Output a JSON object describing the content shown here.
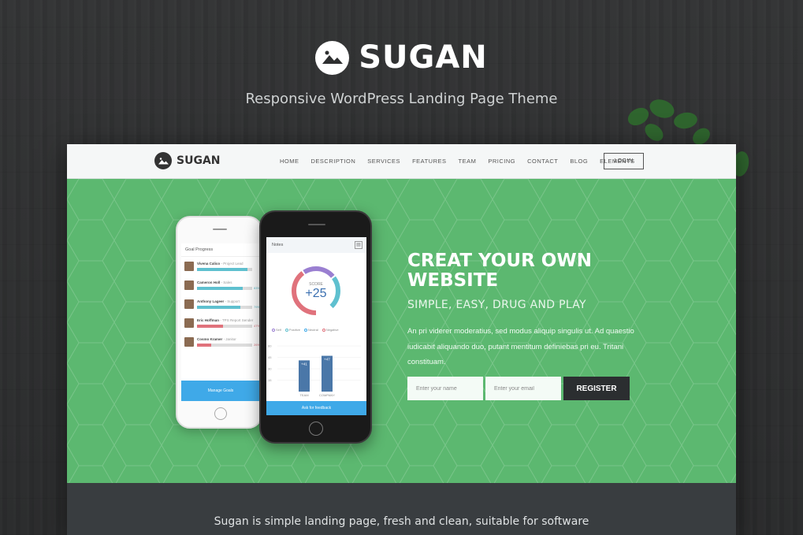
{
  "brand": {
    "name": "SUGAN",
    "tagline": "Responsive WordPress Landing Page Theme"
  },
  "mock": {
    "logo_text": "SUGAN",
    "nav": [
      "HOME",
      "DESCRIPTION",
      "SERVICES",
      "FEATURES",
      "TEAM",
      "PRICING",
      "CONTACT",
      "BLOG",
      "ELEMENTS"
    ],
    "login": "LOGIN",
    "hero": {
      "title": "CREAT YOUR OWN WEBSITE",
      "subtitle": "SIMPLE, EASY, DRUG AND PLAY",
      "description": "An pri viderer moderatius, sed modus aliquip singulis ut. Ad quaestio iudicabit aliquando duo, putant mentitum definiebas pri eu. Tritani constituam.",
      "name_placeholder": "Enter your name",
      "email_placeholder": "Enter your email",
      "register": "REGISTER"
    },
    "phone_white": {
      "title": "Goal Progress",
      "rows": [
        {
          "name": "Vivena Calico",
          "role": "Project Lead",
          "pct": "",
          "fill": 0.92,
          "color": "#5fc0cf"
        },
        {
          "name": "Cameron Holl",
          "role": "Sales",
          "pct": "83%",
          "fill": 0.83,
          "color": "#5fc0cf"
        },
        {
          "name": "Anthony Lageer",
          "role": "Support",
          "pct": "79%",
          "fill": 0.79,
          "color": "#5fc0cf"
        },
        {
          "name": "Eric Hoffman",
          "role": "TPS Report Sender",
          "pct": "47%",
          "fill": 0.47,
          "color": "#e0727c"
        },
        {
          "name": "Cosmo Kramer",
          "role": "Janitor",
          "pct": "26%",
          "fill": 0.26,
          "color": "#e0727c"
        }
      ],
      "manage": "Manage Goals",
      "badge": "%"
    },
    "phone_black": {
      "title": "Notes",
      "score_label": "SCORE",
      "score_value": "+25",
      "legend": [
        {
          "label": "Self",
          "color": "#9a7fd1"
        },
        {
          "label": "Positive",
          "color": "#5fc0cf"
        },
        {
          "label": "Neutral",
          "color": "#3fa9e8"
        },
        {
          "label": "Negative",
          "color": "#e0727c"
        }
      ],
      "y_ticks": [
        "60",
        "45",
        "30",
        "15"
      ],
      "bars": [
        {
          "label": "TEAM",
          "value_label": "+41",
          "value": 41
        },
        {
          "label": "COMPANY",
          "value_label": "+47",
          "value": 47
        }
      ],
      "feedback": "Ask for feedback"
    },
    "footer_text": "Sugan is simple landing page, fresh and clean, suitable for software"
  },
  "chart_data": {
    "type": "bar",
    "categories": [
      "TEAM",
      "COMPANY"
    ],
    "values": [
      41,
      47
    ],
    "ylim": [
      0,
      60
    ]
  }
}
